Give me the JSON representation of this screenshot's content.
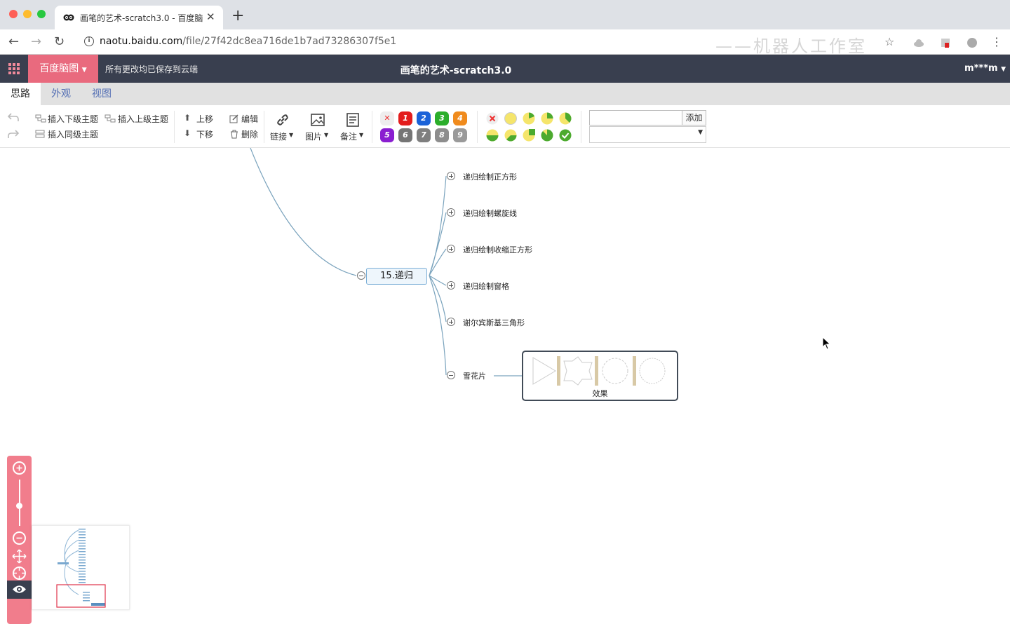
{
  "browser": {
    "tab_title": "画笔的艺术-scratch3.0 - 百度脑图",
    "url_host": "naotu.baidu.com",
    "url_path": "/file/27f42dc8ea716de1b7ad73286307f5e1",
    "watermark": "——机器人工作室"
  },
  "app": {
    "brand": "百度脑图",
    "save_status": "所有更改均已保存到云端",
    "doc_title": "画笔的艺术-scratch3.0",
    "user": "m***m"
  },
  "menu_tabs": [
    "思路",
    "外观",
    "视图"
  ],
  "toolbar": {
    "insert_child": "插入下级主题",
    "insert_parent": "插入上级主题",
    "insert_sibling": "插入同级主题",
    "move_up": "上移",
    "move_down": "下移",
    "edit": "编辑",
    "delete": "删除",
    "link": "链接",
    "image": "图片",
    "note": "备注",
    "priorities": [
      "1",
      "2",
      "3",
      "4",
      "5",
      "6",
      "7",
      "8",
      "9"
    ],
    "tag_add": "添加"
  },
  "colors": {
    "appbar": "#393f4f",
    "brand": "#e96a7e",
    "accent_tab": "#546fb4",
    "edge": "#7aa3bd"
  },
  "mindmap": {
    "main_topic": "15.递归",
    "children": [
      "递归绘制正方形",
      "递归绘制螺旋线",
      "递归绘制收缩正方形",
      "递归绘制窗格",
      "谢尔宾斯基三角形",
      "雪花片"
    ],
    "image_node_caption": "效果"
  }
}
